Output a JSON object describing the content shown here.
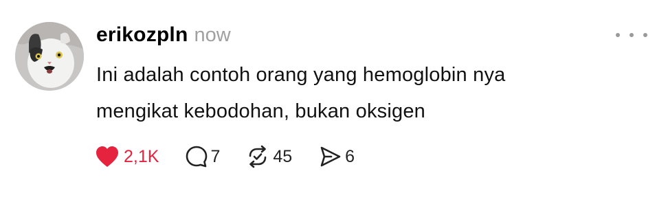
{
  "post": {
    "author": {
      "username": "erikozpln",
      "avatar_icon": "cat-avatar"
    },
    "timestamp": "now",
    "text_lines": [
      "Ini adalah contoh orang yang hemoglobin nya",
      "mengikat kebodohan, bukan oksigen"
    ],
    "actions": {
      "like": {
        "icon": "heart-icon",
        "count": "2,1K",
        "liked": true
      },
      "comment": {
        "icon": "comment-icon",
        "count": "7"
      },
      "repost": {
        "icon": "repost-icon",
        "count": "45"
      },
      "share": {
        "icon": "send-icon",
        "count": "6"
      }
    },
    "more_icon": "more-options-icon"
  },
  "colors": {
    "like_active": "#e5233e",
    "timestamp": "#a0a0a0",
    "text": "#111111"
  }
}
